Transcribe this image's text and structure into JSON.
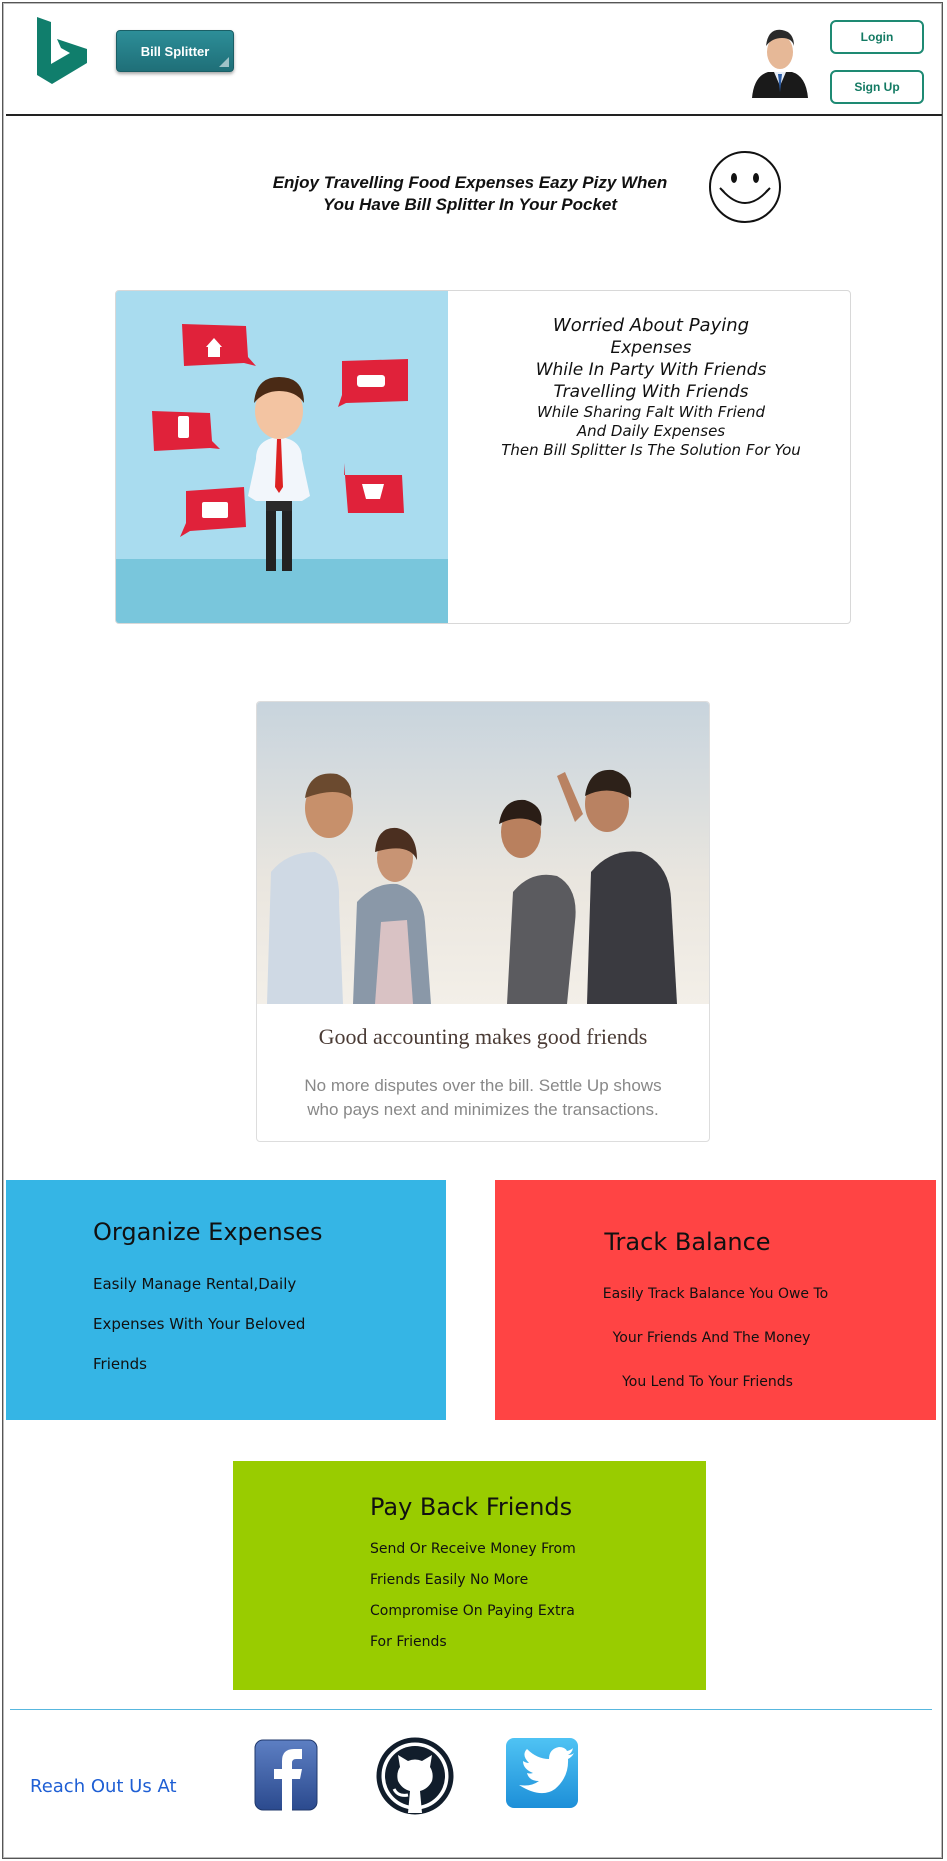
{
  "header": {
    "app_button_label": "Bill Splitter",
    "login_label": "Login",
    "signup_label": "Sign Up"
  },
  "tagline": {
    "line1": "Enjoy Travelling Food Expenses Eazy Pizy When",
    "line2": "You Have Bill Splitter In Your Pocket"
  },
  "worry_card": {
    "lines": [
      "Worried About Paying",
      "Expenses",
      "While In Party With Friends",
      "Travelling With Friends",
      "While Sharing Falt With Friend",
      "And Daily Expenses",
      "Then Bill Splitter Is The Solution For You"
    ]
  },
  "friends_card": {
    "title": "Good accounting makes good friends",
    "desc_line1": "No more disputes over the bill. Settle Up shows",
    "desc_line2": "who pays next and minimizes the transactions."
  },
  "features": {
    "organize": {
      "title": "Organize Expenses",
      "lines": [
        "Easily Manage Rental,Daily",
        "Expenses With Your Beloved",
        "Friends"
      ],
      "color": "#35b5e5"
    },
    "track": {
      "title": "Track Balance",
      "lines": [
        "Easily Track Balance You Owe To",
        "Your  Friends And The Money",
        "You Lend To Your Friends"
      ],
      "color": "#ff4444"
    },
    "payback": {
      "title": "Pay Back Friends",
      "lines": [
        "Send Or Receive Money From",
        "Friends Easily No More",
        "Compromise On Paying Extra",
        "For Friends"
      ],
      "color": "#99cc00"
    }
  },
  "footer": {
    "reach_label": "Reach Out Us At",
    "social": [
      "facebook-icon",
      "github-icon",
      "twitter-icon"
    ]
  },
  "colors": {
    "brand_teal": "#1e8a73",
    "link_blue": "#1f5fd4"
  }
}
